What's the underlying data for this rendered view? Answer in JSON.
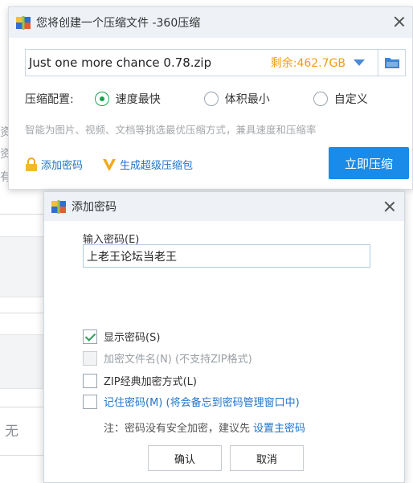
{
  "background": {
    "partial_chars": [
      "资",
      "资",
      "有"
    ],
    "bottom_text": "无"
  },
  "main_window": {
    "title": "您将创建一个压缩文件 -360压缩",
    "archive_name": "Just one more chance 0.78.zip",
    "free_space": "剩余:462.7GB",
    "config_label": "压缩配置:",
    "options": [
      {
        "label": "速度最快",
        "selected": true
      },
      {
        "label": "体积最小",
        "selected": false
      },
      {
        "label": "自定义",
        "selected": false
      }
    ],
    "hint": "智能为图片、视频、文档等挑选最优压缩方式，兼具速度和压缩率",
    "add_password": "添加密码",
    "super_package": "生成超级压缩包",
    "compress_button": "立即压缩",
    "colors": {
      "accent": "#1a8be8",
      "warning": "#f39c12",
      "link": "#1e73c9"
    }
  },
  "password_dialog": {
    "title": "添加密码",
    "field_label": "输入密码(E)",
    "password_value": "上老王论坛当老王",
    "show_password": {
      "label": "显示密码(S)",
      "checked": true
    },
    "encrypt_names": {
      "label": "加密文件名(N) (不支持ZIP格式)",
      "checked": false,
      "disabled": true
    },
    "zip_classic": {
      "label": "ZIP经典加密方式(L)",
      "checked": false
    },
    "remember": {
      "label": "记住密码(M) (将会备忘到密码管理窗口中)",
      "checked": false
    },
    "note": "注：密码没有安全加密，建议先",
    "note_link": "设置主密码",
    "ok": "确认",
    "cancel": "取消"
  }
}
